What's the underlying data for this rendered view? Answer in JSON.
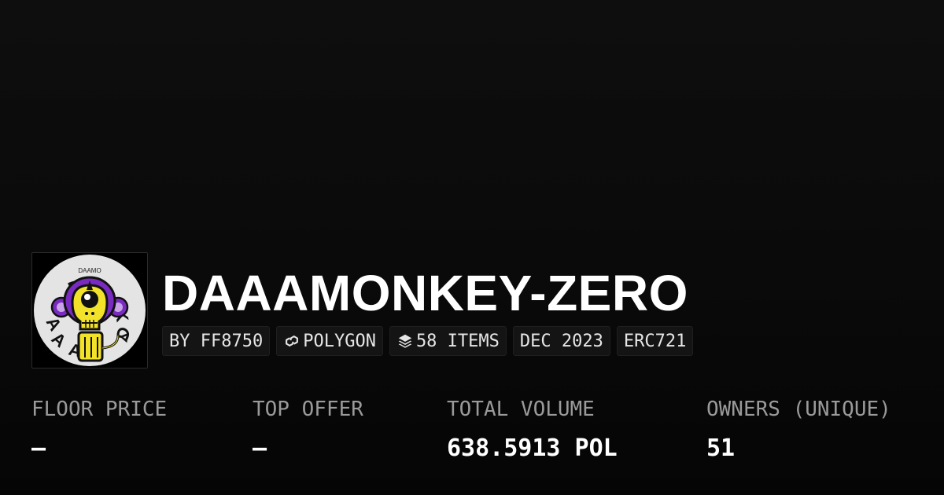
{
  "collection": {
    "name": "DAAAMONKEY-ZERO",
    "avatar_text": "DAAMO"
  },
  "tags": [
    {
      "label": "BY FF8750",
      "icon": null
    },
    {
      "label": "POLYGON",
      "icon": "polygon-chain-icon"
    },
    {
      "label": "58 ITEMS",
      "icon": "layers-icon"
    },
    {
      "label": "DEC 2023",
      "icon": null
    },
    {
      "label": "ERC721",
      "icon": null
    }
  ],
  "stats": [
    {
      "label": "FLOOR PRICE",
      "value": "—"
    },
    {
      "label": "TOP OFFER",
      "value": "—"
    },
    {
      "label": "TOTAL VOLUME",
      "value": "638.5913 POL"
    },
    {
      "label": "OWNERS (UNIQUE)",
      "value": "51"
    }
  ],
  "colors": {
    "background": "#0a0a0a",
    "tag_background": "#141414",
    "label_gray": "#9a9a9a",
    "avatar_purple": "#7a2bbf",
    "avatar_yellow": "#f2e22a"
  }
}
